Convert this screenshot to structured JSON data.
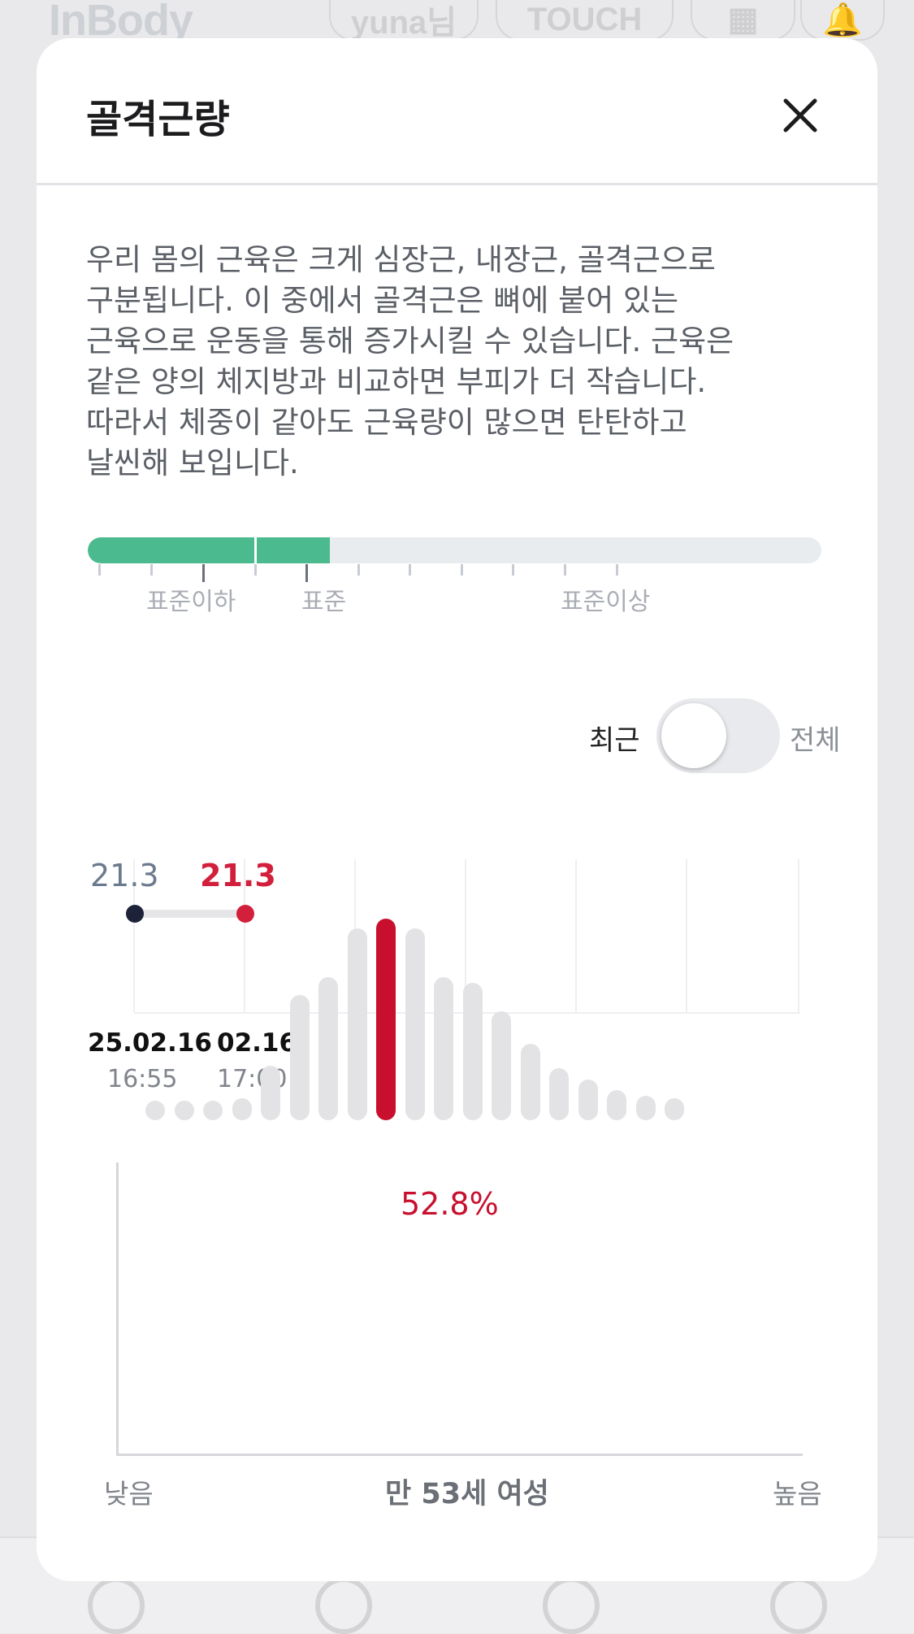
{
  "background": {
    "logo": "InBody",
    "user": "yuna님",
    "touch": "TOUCH"
  },
  "modal": {
    "title": "골격근량",
    "description": "우리 몸의 근육은 크게 심장근, 내장근, 골격근으로\n구분됩니다. 이 중에서 골격근은 뼈에 붙어 있는\n근육으로 운동을 통해 증가시킬 수 있습니다. 근육은\n같은 양의 체지방과 비교하면 부피가 더 작습니다.\n따라서 체중이 같아도 근육량이 많으면 탄탄하고\n날씬해 보입니다.",
    "range": {
      "labels": [
        "표준이하",
        "표준",
        "표준이상"
      ],
      "fill_ratio": 0.33,
      "color": "#4cba8f"
    },
    "toggle": {
      "left_label": "최근",
      "right_label": "전체",
      "state": "recent"
    },
    "history": {
      "points": [
        {
          "value": "21.3",
          "date": "25.02.16",
          "time": "16:55",
          "color": "#1c2237",
          "label_color": "#6b7a8c"
        },
        {
          "value": "21.3",
          "date": "02.16",
          "time": "17:00",
          "color": "#d21f3c",
          "label_color": "#d21f3c"
        }
      ]
    },
    "distribution": {
      "percent_label": "52.8%",
      "low_label": "낮음",
      "high_label": "높음",
      "group_label": "만 53세 여성",
      "highlight_color": "#c8102e",
      "bars": [
        0.06,
        0.06,
        0.06,
        0.11,
        0.27,
        0.62,
        0.71,
        0.95,
        1.0,
        0.95,
        0.71,
        0.68,
        0.54,
        0.38,
        0.26,
        0.2,
        0.15,
        0.12,
        0.11
      ],
      "highlight_index": 8
    }
  }
}
